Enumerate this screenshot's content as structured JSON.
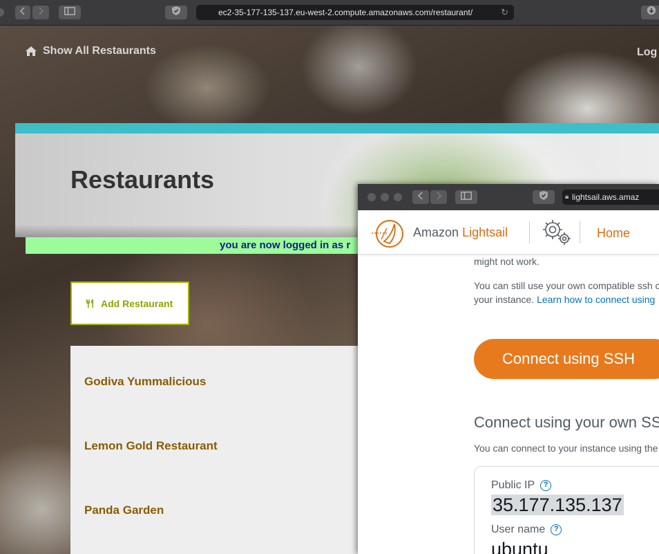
{
  "main_browser": {
    "url": "ec2-35-177-135-137.eu-west-2.compute.amazonaws.com/restaurant/",
    "back_icon": "chevron-left-icon",
    "forward_icon": "chevron-right-icon",
    "sidebar_icon": "sidebar-icon",
    "shield_icon": "shield-icon",
    "reload_icon": "reload-icon",
    "download_icon": "download-icon"
  },
  "restaurant_page": {
    "nav": {
      "home_label": "Show All Restaurants",
      "login_label": "Log"
    },
    "banner_title": "Restaurants",
    "login_message": "you are now logged in as r",
    "add_button_label": "Add Restaurant",
    "restaurants": [
      {
        "name": "Godiva Yummalicious"
      },
      {
        "name": "Lemon Gold Restaurant"
      },
      {
        "name": "Panda Garden"
      }
    ],
    "colors": {
      "teal_bar": "#3ebec9",
      "message_bg": "#9dfb9a",
      "message_text": "#0d1f86",
      "add_button": "#8ea300",
      "restaurant_link": "#8a5c00"
    }
  },
  "lightsail_window": {
    "url": "lightsail.aws.amaz",
    "brand_prefix": "Amazon",
    "brand_name": "Lightsail",
    "home_label": "Home",
    "text_partial": "might not work.",
    "text_own_ssh_line1": "You can still use your own compatible ssh c",
    "text_own_ssh_line2_prefix": "your instance.",
    "learn_link": "Learn how to connect using",
    "connect_button": "Connect using SSH",
    "own_ssh_heading": "Connect using your own SS",
    "own_ssh_desc": "You can connect to your instance using the",
    "public_ip_label": "Public IP",
    "public_ip_value": "35.177.135.137",
    "user_name_label": "User name",
    "user_name_value": "ubuntu",
    "help_icon_text": "?",
    "colors": {
      "accent_orange": "#dd6b10",
      "button_orange": "#e87a1e",
      "link_blue": "#0073bb"
    }
  }
}
